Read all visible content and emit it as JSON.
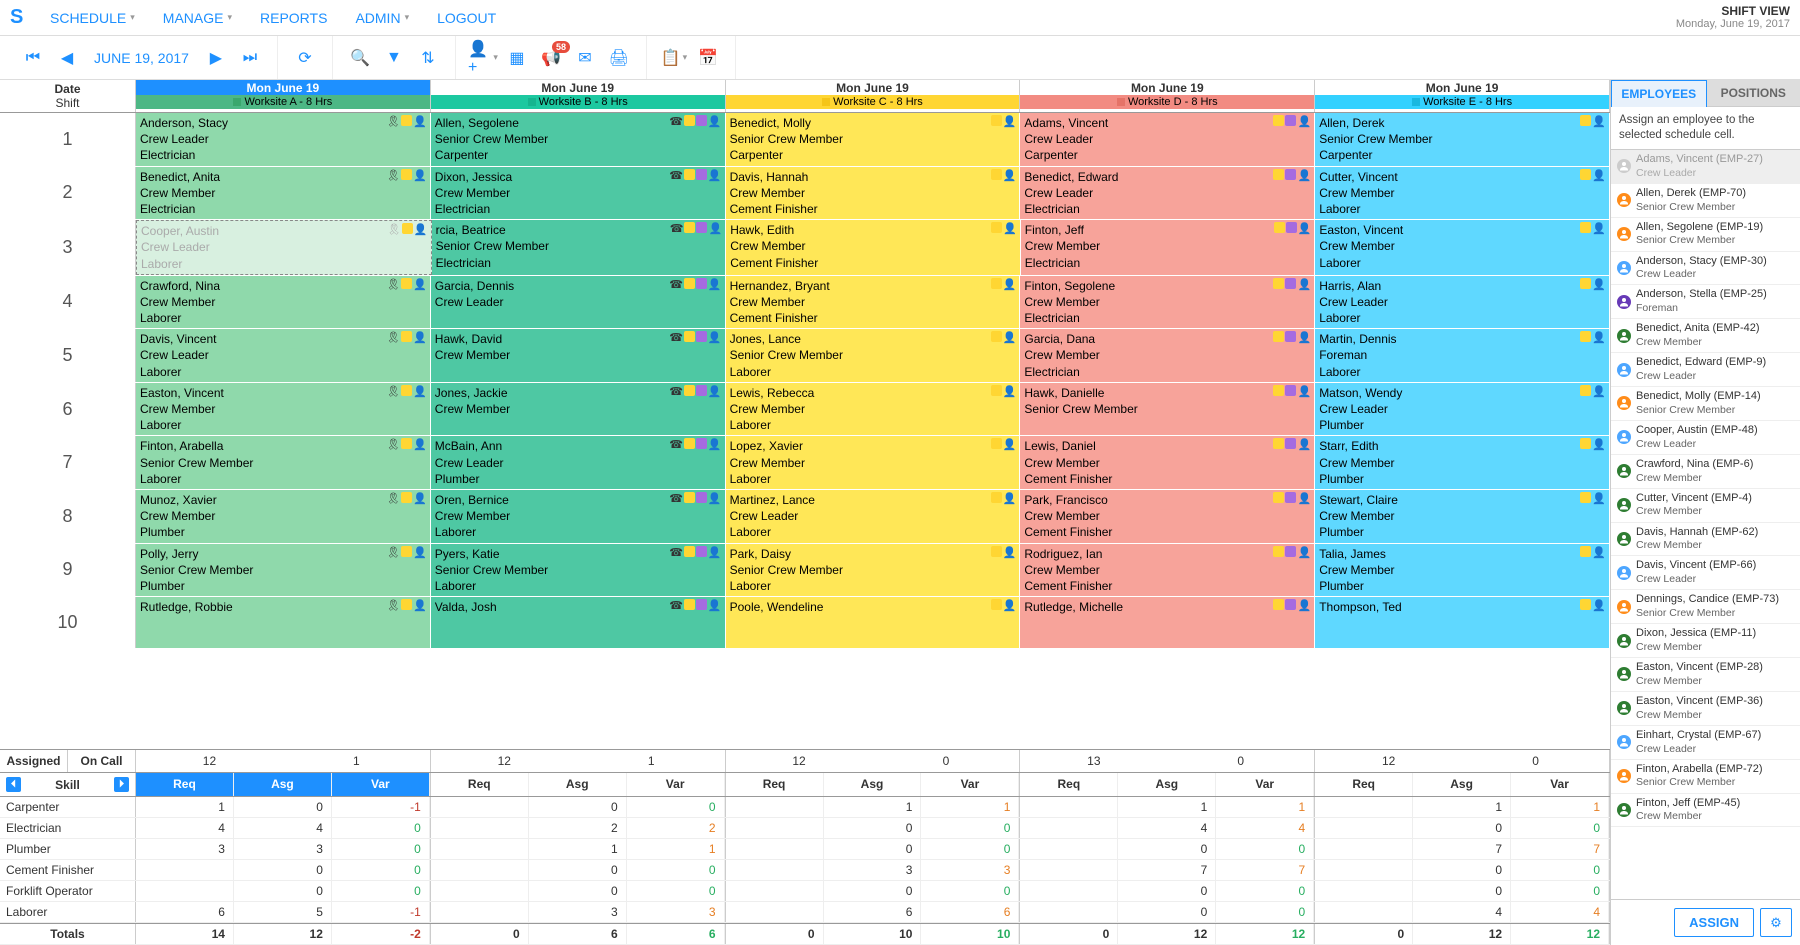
{
  "nav": {
    "items": [
      "SCHEDULE",
      "MANAGE",
      "REPORTS",
      "ADMIN",
      "LOGOUT"
    ],
    "title": "SHIFT VIEW",
    "subtitle": "Monday, June 19, 2017"
  },
  "toolbar": {
    "date": "JUNE 19, 2017",
    "notif_count": "58"
  },
  "headers": {
    "date_label": "Date",
    "shift_label": "Shift",
    "columns": [
      {
        "day": "Mon June 19",
        "worksite": "Worksite A - 8 Hrs",
        "active": true,
        "cls": "w-a",
        "sq": "sq-a"
      },
      {
        "day": "Mon June 19",
        "worksite": "Worksite B - 8 Hrs",
        "cls": "w-b",
        "sq": "sq-b"
      },
      {
        "day": "Mon June 19",
        "worksite": "Worksite C - 8 Hrs",
        "cls": "w-c",
        "sq": "sq-c"
      },
      {
        "day": "Mon June 19",
        "worksite": "Worksite D - 8 Hrs",
        "cls": "w-d",
        "sq": "sq-d"
      },
      {
        "day": "Mon June 19",
        "worksite": "Worksite E - 8 Hrs",
        "cls": "w-e",
        "sq": "sq-e"
      }
    ]
  },
  "shifts": [
    {
      "n": "1",
      "cells": [
        {
          "c": "cell-a",
          "name": "Anderson, Stacy",
          "role": "Crew Leader",
          "skill": "Electrician"
        },
        {
          "c": "cell-b",
          "name": "Allen, Segolene",
          "role": "Senior Crew Member",
          "skill": "Carpenter"
        },
        {
          "c": "cell-c",
          "name": "Benedict, Molly",
          "role": "Senior Crew Member",
          "skill": "Carpenter"
        },
        {
          "c": "cell-d",
          "name": "Adams, Vincent",
          "role": "Crew Leader",
          "skill": "Carpenter"
        },
        {
          "c": "cell-e",
          "name": "Allen, Derek",
          "role": "Senior Crew Member",
          "skill": "Carpenter"
        }
      ]
    },
    {
      "n": "2",
      "cells": [
        {
          "c": "cell-a",
          "name": "Benedict, Anita",
          "role": "Crew Member",
          "skill": "Electrician"
        },
        {
          "c": "cell-b",
          "name": "Dixon, Jessica",
          "role": "Crew Member",
          "skill": "Electrician"
        },
        {
          "c": "cell-c",
          "name": "Davis, Hannah",
          "role": "Crew Member",
          "skill": "Cement Finisher"
        },
        {
          "c": "cell-d",
          "name": "Benedict, Edward",
          "role": "Crew Leader",
          "skill": "Electrician"
        },
        {
          "c": "cell-e",
          "name": "Cutter, Vincent",
          "role": "Crew Member",
          "skill": "Laborer"
        }
      ]
    },
    {
      "n": "3",
      "cells": [
        {
          "c": "cell-a ghost",
          "name": "Cooper, Austin",
          "role": "Crew Leader",
          "skill": "Laborer"
        },
        {
          "c": "cell-b",
          "name": "rcia, Beatrice",
          "role": "Senior Crew Member",
          "skill": "Electrician"
        },
        {
          "c": "cell-c",
          "name": "Hawk, Edith",
          "role": "Crew Member",
          "skill": "Cement Finisher"
        },
        {
          "c": "cell-d",
          "name": "Finton, Jeff",
          "role": "Crew Member",
          "skill": "Electrician"
        },
        {
          "c": "cell-e",
          "name": "Easton, Vincent",
          "role": "Crew Member",
          "skill": "Laborer"
        }
      ]
    },
    {
      "n": "4",
      "cells": [
        {
          "c": "cell-a",
          "name": "Crawford, Nina",
          "role": "Crew Member",
          "skill": "Laborer"
        },
        {
          "c": "cell-b",
          "name": "Garcia, Dennis",
          "role": "Crew Leader",
          "skill": ""
        },
        {
          "c": "cell-c",
          "name": "Hernandez, Bryant",
          "role": "Crew Member",
          "skill": "Cement Finisher"
        },
        {
          "c": "cell-d",
          "name": "Finton, Segolene",
          "role": "Crew Member",
          "skill": "Electrician"
        },
        {
          "c": "cell-e",
          "name": "Harris, Alan",
          "role": "Crew Leader",
          "skill": "Laborer"
        }
      ]
    },
    {
      "n": "5",
      "cells": [
        {
          "c": "cell-a",
          "name": "Davis, Vincent",
          "role": "Crew Leader",
          "skill": "Laborer"
        },
        {
          "c": "cell-b",
          "name": "Hawk, David",
          "role": "Crew Member",
          "skill": ""
        },
        {
          "c": "cell-c",
          "name": "Jones, Lance",
          "role": "Senior Crew Member",
          "skill": "Laborer"
        },
        {
          "c": "cell-d",
          "name": "Garcia, Dana",
          "role": "Crew Member",
          "skill": "Electrician"
        },
        {
          "c": "cell-e",
          "name": "Martin, Dennis",
          "role": "Foreman",
          "skill": "Laborer"
        }
      ]
    },
    {
      "n": "6",
      "cells": [
        {
          "c": "cell-a",
          "name": "Easton, Vincent",
          "role": "Crew Member",
          "skill": "Laborer"
        },
        {
          "c": "cell-b",
          "name": "Jones, Jackie",
          "role": "Crew Member",
          "skill": ""
        },
        {
          "c": "cell-c",
          "name": "Lewis, Rebecca",
          "role": "Crew Member",
          "skill": "Laborer"
        },
        {
          "c": "cell-d",
          "name": "Hawk, Danielle",
          "role": "Senior Crew Member",
          "skill": ""
        },
        {
          "c": "cell-e",
          "name": "Matson, Wendy",
          "role": "Crew Leader",
          "skill": "Plumber"
        }
      ]
    },
    {
      "n": "7",
      "cells": [
        {
          "c": "cell-a",
          "name": "Finton, Arabella",
          "role": "Senior Crew Member",
          "skill": "Laborer"
        },
        {
          "c": "cell-b",
          "name": "McBain, Ann",
          "role": "Crew Leader",
          "skill": "Plumber"
        },
        {
          "c": "cell-c",
          "name": "Lopez, Xavier",
          "role": "Crew Member",
          "skill": "Laborer"
        },
        {
          "c": "cell-d",
          "name": "Lewis, Daniel",
          "role": "Crew Member",
          "skill": "Cement Finisher"
        },
        {
          "c": "cell-e",
          "name": "Starr, Edith",
          "role": "Crew Member",
          "skill": "Plumber"
        }
      ]
    },
    {
      "n": "8",
      "cells": [
        {
          "c": "cell-a",
          "name": "Munoz, Xavier",
          "role": "Crew Member",
          "skill": "Plumber"
        },
        {
          "c": "cell-b",
          "name": "Oren, Bernice",
          "role": "Crew Member",
          "skill": "Laborer"
        },
        {
          "c": "cell-c",
          "name": "Martinez, Lance",
          "role": "Crew Leader",
          "skill": "Laborer"
        },
        {
          "c": "cell-d",
          "name": "Park, Francisco",
          "role": "Crew Member",
          "skill": "Cement Finisher"
        },
        {
          "c": "cell-e",
          "name": "Stewart, Claire",
          "role": "Crew Member",
          "skill": "Plumber"
        }
      ]
    },
    {
      "n": "9",
      "cells": [
        {
          "c": "cell-a",
          "name": "Polly, Jerry",
          "role": "Senior Crew Member",
          "skill": "Plumber"
        },
        {
          "c": "cell-b",
          "name": "Pyers, Katie",
          "role": "Senior Crew Member",
          "skill": "Laborer"
        },
        {
          "c": "cell-c",
          "name": "Park, Daisy",
          "role": "Senior Crew Member",
          "skill": "Laborer"
        },
        {
          "c": "cell-d",
          "name": "Rodriguez, Ian",
          "role": "Crew Member",
          "skill": "Cement Finisher"
        },
        {
          "c": "cell-e",
          "name": "Talia, James",
          "role": "Crew Member",
          "skill": "Plumber"
        }
      ]
    },
    {
      "n": "10",
      "cells": [
        {
          "c": "cell-a",
          "name": "Rutledge, Robbie",
          "role": "",
          "skill": ""
        },
        {
          "c": "cell-b",
          "name": "Valda, Josh",
          "role": "",
          "skill": ""
        },
        {
          "c": "cell-c",
          "name": "Poole, Wendeline",
          "role": "",
          "skill": ""
        },
        {
          "c": "cell-d",
          "name": "Rutledge, Michelle",
          "role": "",
          "skill": ""
        },
        {
          "c": "cell-e",
          "name": "Thompson, Ted",
          "role": "",
          "skill": ""
        }
      ]
    }
  ],
  "assigned": {
    "labels": [
      "Assigned",
      "On Call"
    ],
    "values": [
      [
        "12",
        "1"
      ],
      [
        "12",
        "1"
      ],
      [
        "12",
        "0"
      ],
      [
        "13",
        "0"
      ],
      [
        "12",
        "0"
      ]
    ]
  },
  "skills": {
    "label": "Skill",
    "headers": [
      "Req",
      "Asg",
      "Var"
    ],
    "rows": [
      {
        "name": "Carpenter",
        "v": [
          [
            "1",
            "0",
            "-1"
          ],
          [
            "",
            "0",
            "0"
          ],
          [
            "",
            "1",
            "1"
          ],
          [
            "",
            "1",
            "1"
          ],
          [
            "",
            "1",
            "1"
          ]
        ]
      },
      {
        "name": "Electrician",
        "v": [
          [
            "4",
            "4",
            "0"
          ],
          [
            "",
            "2",
            "2"
          ],
          [
            "",
            "0",
            "0"
          ],
          [
            "",
            "4",
            "4"
          ],
          [
            "",
            "0",
            "0"
          ]
        ]
      },
      {
        "name": "Plumber",
        "v": [
          [
            "3",
            "3",
            "0"
          ],
          [
            "",
            "1",
            "1"
          ],
          [
            "",
            "0",
            "0"
          ],
          [
            "",
            "0",
            "0"
          ],
          [
            "",
            "7",
            "7"
          ]
        ]
      },
      {
        "name": "Cement Finisher",
        "v": [
          [
            "",
            "0",
            "0"
          ],
          [
            "",
            "0",
            "0"
          ],
          [
            "",
            "3",
            "3"
          ],
          [
            "",
            "7",
            "7"
          ],
          [
            "",
            "0",
            "0"
          ]
        ]
      },
      {
        "name": "Forklift Operator",
        "v": [
          [
            "",
            "0",
            "0"
          ],
          [
            "",
            "0",
            "0"
          ],
          [
            "",
            "0",
            "0"
          ],
          [
            "",
            "0",
            "0"
          ],
          [
            "",
            "0",
            "0"
          ]
        ]
      },
      {
        "name": "Laborer",
        "v": [
          [
            "6",
            "5",
            "-1"
          ],
          [
            "",
            "3",
            "3"
          ],
          [
            "",
            "6",
            "6"
          ],
          [
            "",
            "0",
            "0"
          ],
          [
            "",
            "4",
            "4"
          ]
        ]
      }
    ],
    "totals": {
      "name": "Totals",
      "v": [
        [
          "14",
          "12",
          "-2"
        ],
        [
          "0",
          "6",
          "6"
        ],
        [
          "0",
          "10",
          "10"
        ],
        [
          "0",
          "12",
          "12"
        ],
        [
          "0",
          "12",
          "12"
        ]
      ]
    }
  },
  "sidebar": {
    "tabs": [
      "EMPLOYEES",
      "POSITIONS"
    ],
    "hint": "Assign an employee to the selected schedule cell.",
    "assign_label": "ASSIGN",
    "roles": {
      "leader": "role-leader",
      "senior": "role-senior",
      "member": "role-member",
      "foreman": "role-foreman",
      "ghost": "role-ghost"
    },
    "employees": [
      {
        "name": "Adams, Vincent (EMP-27)",
        "role": "Crew Leader",
        "rc": "ghost",
        "sel": true
      },
      {
        "name": "Allen, Derek (EMP-70)",
        "role": "Senior Crew Member",
        "rc": "senior"
      },
      {
        "name": "Allen, Segolene (EMP-19)",
        "role": "Senior Crew Member",
        "rc": "senior"
      },
      {
        "name": "Anderson, Stacy (EMP-30)",
        "role": "Crew Leader",
        "rc": "leader"
      },
      {
        "name": "Anderson, Stella (EMP-25)",
        "role": "Foreman",
        "rc": "foreman"
      },
      {
        "name": "Benedict, Anita (EMP-42)",
        "role": "Crew Member",
        "rc": "member"
      },
      {
        "name": "Benedict, Edward (EMP-9)",
        "role": "Crew Leader",
        "rc": "leader"
      },
      {
        "name": "Benedict, Molly (EMP-14)",
        "role": "Senior Crew Member",
        "rc": "senior"
      },
      {
        "name": "Cooper, Austin (EMP-48)",
        "role": "Crew Leader",
        "rc": "leader"
      },
      {
        "name": "Crawford, Nina (EMP-6)",
        "role": "Crew Member",
        "rc": "member"
      },
      {
        "name": "Cutter, Vincent (EMP-4)",
        "role": "Crew Member",
        "rc": "member"
      },
      {
        "name": "Davis, Hannah (EMP-62)",
        "role": "Crew Member",
        "rc": "member"
      },
      {
        "name": "Davis, Vincent (EMP-66)",
        "role": "Crew Leader",
        "rc": "leader"
      },
      {
        "name": "Dennings, Candice (EMP-73)",
        "role": "Senior Crew Member",
        "rc": "senior"
      },
      {
        "name": "Dixon, Jessica (EMP-11)",
        "role": "Crew Member",
        "rc": "member"
      },
      {
        "name": "Easton, Vincent (EMP-28)",
        "role": "Crew Member",
        "rc": "member"
      },
      {
        "name": "Easton, Vincent (EMP-36)",
        "role": "Crew Member",
        "rc": "member"
      },
      {
        "name": "Einhart, Crystal (EMP-67)",
        "role": "Crew Leader",
        "rc": "leader"
      },
      {
        "name": "Finton, Arabella (EMP-72)",
        "role": "Senior Crew Member",
        "rc": "senior"
      },
      {
        "name": "Finton, Jeff (EMP-45)",
        "role": "Crew Member",
        "rc": "member"
      }
    ]
  }
}
